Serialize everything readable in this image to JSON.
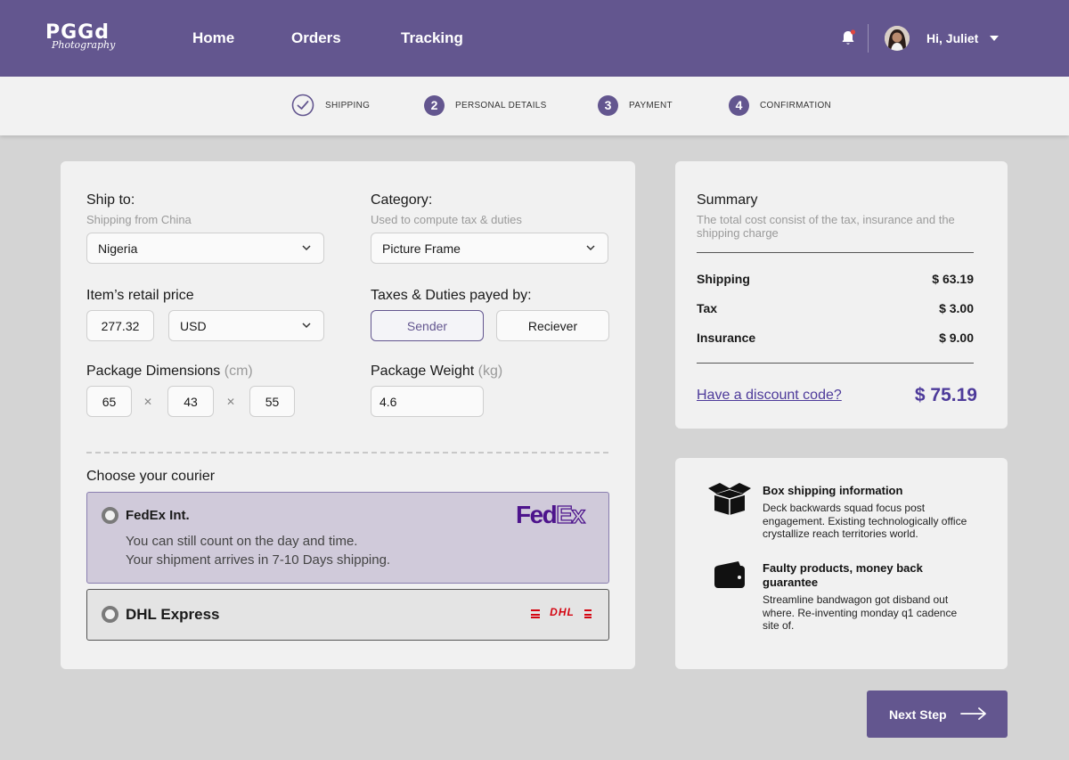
{
  "header": {
    "logo_big": "PGGd",
    "logo_script": "Photography",
    "nav": [
      "Home",
      "Orders",
      "Tracking"
    ],
    "greeting": "Hi, Juliet",
    "accent_color": "#63568f",
    "notification_dot_color": "#e0463f"
  },
  "stepper": {
    "steps": [
      {
        "marker": "check",
        "label": "SHIPPING"
      },
      {
        "marker": "2",
        "label": "PERSONAL DETAILS"
      },
      {
        "marker": "3",
        "label": "PAYMENT"
      },
      {
        "marker": "4",
        "label": "CONFIRMATION"
      }
    ]
  },
  "form": {
    "ship_to": {
      "label": "Ship to:",
      "sub": "Shipping from China",
      "value": "Nigeria"
    },
    "category": {
      "label": "Category:",
      "sub": "Used to compute tax & duties",
      "value": "Picture Frame"
    },
    "retail_price": {
      "label": "Item’s retail price",
      "value": "277.32",
      "currency": "USD"
    },
    "taxes_paid_by": {
      "label": "Taxes & Duties payed by:",
      "options": [
        "Sender",
        "Reciever"
      ],
      "selected": "Sender"
    },
    "dimensions": {
      "label": "Package Dimensions",
      "unit": "(cm)",
      "values": [
        "65",
        "43",
        "55"
      ],
      "separator": "✕"
    },
    "weight": {
      "label": "Package Weight",
      "unit": "(kg)",
      "value": "4.6"
    },
    "courier": {
      "label": "Choose your courier",
      "options": [
        {
          "name": "FedEx Int.",
          "desc": [
            "You can still count on the day and time.",
            "Your shipment arrives in 7-10 Days shipping."
          ],
          "logo_a": "Fed",
          "logo_b": "Ex",
          "selected": true
        },
        {
          "name": "DHL Express",
          "logo": "DHL",
          "selected": false
        }
      ]
    }
  },
  "summary": {
    "title": "Summary",
    "sub": "The total cost consist of the tax, insurance and the shipping charge",
    "rows": [
      {
        "label": "Shipping",
        "value": "$ 63.19"
      },
      {
        "label": "Tax",
        "value": "$ 3.00"
      },
      {
        "label": "Insurance",
        "value": "$ 9.00"
      }
    ],
    "discount_link": "Have a discount code?",
    "total": "$ 75.19"
  },
  "info": [
    {
      "icon": "box-icon",
      "title": "Box shipping information",
      "text": "Deck backwards squad focus post engagement. Existing technologically office crystallize reach territories world."
    },
    {
      "icon": "wallet-icon",
      "title": "Faulty products, money back guarantee",
      "text": "Streamline bandwagon got disband out where. Re-inventing monday q1 cadence site of."
    }
  ],
  "next_button": "Next Step"
}
